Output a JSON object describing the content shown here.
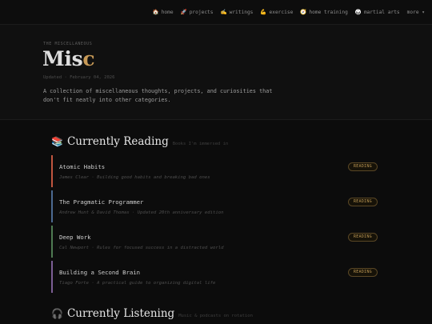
{
  "nav": {
    "items": [
      {
        "icon": "🏠",
        "label": "home"
      },
      {
        "icon": "🚀",
        "label": "projects"
      },
      {
        "icon": "✍️",
        "label": "writings"
      },
      {
        "icon": "💪",
        "label": "exercise"
      },
      {
        "icon": "🧭",
        "label": "home training"
      },
      {
        "icon": "🥋",
        "label": "martial arts"
      }
    ],
    "more": "more ▾"
  },
  "header": {
    "eyebrow": "THE MISCELLANEOUS",
    "title_main": "Mis",
    "title_accent": "c",
    "updated": "Updated · February 04, 2026",
    "intro": "A collection of miscellaneous thoughts, projects, and curiosities that don't fit neatly into other categories."
  },
  "reading": {
    "emoji": "📚",
    "title": "Currently Reading",
    "subtitle": "Books I'm immersed in",
    "books": [
      {
        "title": "Atomic Habits",
        "meta": "James Clear · Building good habits and breaking bad ones",
        "badge": "READING",
        "color": "#c0563f"
      },
      {
        "title": "The Pragmatic Programmer",
        "meta": "Andrew Hunt & David Thomas · Updated 20th anniversary edition",
        "badge": "READING",
        "color": "#4c6a91"
      },
      {
        "title": "Deep Work",
        "meta": "Cal Newport · Rules for focused success in a distracted world",
        "badge": "READING",
        "color": "#4f7a52"
      },
      {
        "title": "Building a Second Brain",
        "meta": "Tiago Forte · A practical guide to organizing digital life",
        "badge": "READING",
        "color": "#7c5e95"
      }
    ]
  },
  "listening": {
    "emoji": "🎧",
    "title": "Currently Listening",
    "subtitle": "Music & podcasts on rotation"
  }
}
